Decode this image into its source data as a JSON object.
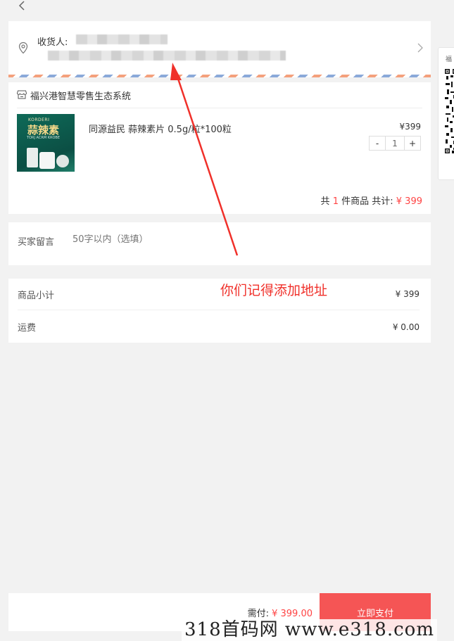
{
  "nav": {
    "back_icon": "chevron-left-icon"
  },
  "address": {
    "receiver_label": "收货人:",
    "location_icon": "location-pin-icon",
    "chevron_icon": "chevron-right-icon"
  },
  "shop": {
    "store_icon": "store-icon",
    "name": "福兴港智慧零售生态系统",
    "product": {
      "image_brand": "KORDERI",
      "image_title": "蒜辣素",
      "image_sub": "TORJ ACRM KROBE",
      "name": "同源益民 蒜辣素片 0.5g/粒*100粒",
      "price": "¥399",
      "quantity": "1",
      "minus": "-",
      "plus": "+"
    },
    "summary": {
      "prefix": "共",
      "count": "1",
      "mid": "件商品 共计:",
      "total": "¥ 399"
    }
  },
  "message": {
    "label": "买家留言",
    "placeholder": "50字以内（选填）"
  },
  "costs": {
    "subtotal_label": "商品小计",
    "subtotal_value": "¥ 399",
    "shipping_label": "运费",
    "shipping_value": "¥ 0.00"
  },
  "annotation": {
    "text": "你们记得添加地址"
  },
  "side_panel": {
    "label": "福"
  },
  "footer": {
    "need_pay_label": "需付:",
    "need_pay_value": "¥ 399.00",
    "pay_button": "立即支付"
  },
  "watermark": {
    "text": "318首码网  www.e318.com"
  },
  "colors": {
    "accent": "#f55555",
    "price_red": "#f44",
    "annotation_red": "#f0302a"
  }
}
